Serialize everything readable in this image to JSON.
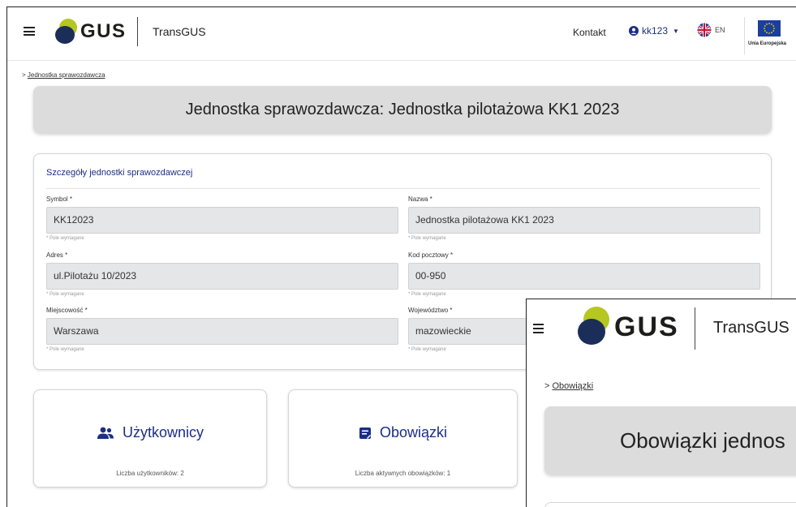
{
  "header": {
    "logo_text": "GUS",
    "app_name": "TransGUS",
    "kontakt": "Kontakt",
    "user": "kk123",
    "language": "EN",
    "eu_label": "Unia Europejska"
  },
  "breadcrumb": "Jednostka sprawozdawcza",
  "page_title": "Jednostka sprawozdawcza: Jednostka pilotażowa KK1 2023",
  "details": {
    "title": "Szczegóły jednostki sprawozdawczej",
    "required_hint": "* Pole wymagane",
    "fields": [
      {
        "label": "Symbol *",
        "value": "KK12023"
      },
      {
        "label": "Nazwa *",
        "value": "Jednostka pilotażowa KK1 2023"
      },
      {
        "label": "Adres *",
        "value": "ul.Pilotażu 10/2023"
      },
      {
        "label": "Kod pocztowy *",
        "value": "00-950"
      },
      {
        "label": "Miejscowość *",
        "value": "Warszawa"
      },
      {
        "label": "Województwo *",
        "value": "mazowieckie"
      }
    ]
  },
  "tiles": [
    {
      "title": "Użytkownicy",
      "subtitle": "Liczba użytkowników: 2",
      "icon": "users-icon"
    },
    {
      "title": "Obowiązki",
      "subtitle": "Liczba aktywnych obowiązków: 1",
      "icon": "form-icon"
    }
  ],
  "overlay": {
    "logo_text": "GUS",
    "app_name": "TransGUS",
    "breadcrumb": "Obowiązki",
    "page_title": "Obowiązki jednos"
  },
  "colors": {
    "accent": "#1b2e84",
    "logo_green": "#b5c720",
    "logo_navy": "#1b2e5a",
    "title_bar": "#dcdcdc",
    "field_bg": "#e5e6e7"
  }
}
